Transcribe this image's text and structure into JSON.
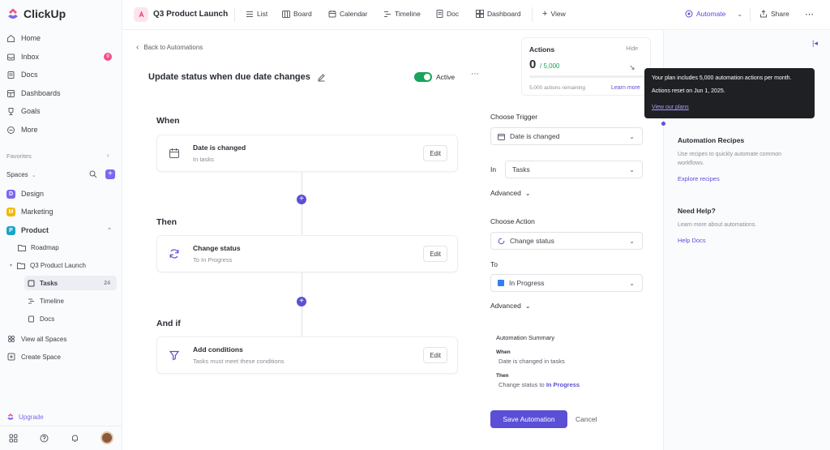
{
  "app": {
    "name": "ClickUp"
  },
  "sidebar": {
    "nav": [
      {
        "label": "Home",
        "icon": "home-icon"
      },
      {
        "label": "Inbox",
        "icon": "inbox-icon",
        "badge": "9"
      },
      {
        "label": "Docs",
        "icon": "doc-icon"
      },
      {
        "label": "Dashboards",
        "icon": "dashboard-icon"
      },
      {
        "label": "Goals",
        "icon": "trophy-icon"
      },
      {
        "label": "More",
        "icon": "more-circle-icon"
      }
    ],
    "favorites_label": "Favorites",
    "spaces_label": "Spaces",
    "spaces": [
      {
        "label": "Design",
        "letter": "D",
        "color": "#7b68ee"
      },
      {
        "label": "Marketing",
        "letter": "M",
        "color": "#f5b800"
      },
      {
        "label": "Product",
        "letter": "P",
        "color": "#1aa3c4"
      }
    ],
    "product_children": {
      "roadmap": "Roadmap",
      "launch": "Q3 Product Launch",
      "tasks": "Tasks",
      "tasks_count": "24",
      "timeline": "Timeline",
      "docs": "Docs"
    },
    "view_all": "View all Spaces",
    "create_space": "Create Space",
    "upgrade": "Upgrade"
  },
  "topbar": {
    "project_title": "Q3 Product Launch",
    "views": [
      "List",
      "Board",
      "Calendar",
      "Timeline",
      "Doc",
      "Dashboard"
    ],
    "add_view": "View",
    "automate": "Automate",
    "share": "Share"
  },
  "builder": {
    "back": "Back to Automations",
    "title": "Update status when due date changes",
    "active_label": "Active",
    "when_label": "When",
    "then_label": "Then",
    "andif_label": "And if",
    "edit_label": "Edit",
    "trigger_card": {
      "title": "Date is changed",
      "sub": "In tasks"
    },
    "action_card": {
      "title": "Change status",
      "sub": "To In Progress"
    },
    "condition_card": {
      "title": "Add conditions",
      "sub": "Tasks must meet these conditions"
    }
  },
  "config": {
    "choose_trigger": "Choose Trigger",
    "trigger_value": "Date is changed",
    "in_label": "In",
    "in_value": "Tasks",
    "advanced": "Advanced",
    "choose_action": "Choose Action",
    "action_value": "Change status",
    "to_label": "To",
    "to_value": "In Progress",
    "to_color": "#2f7ff0",
    "summary": {
      "title": "Automation Summary",
      "when_h": "When",
      "when_v": "Date is changed in tasks",
      "then_h": "Then",
      "then_prefix": "Change status to",
      "then_value": "In Progress"
    },
    "save": "Save Automation",
    "cancel": "Cancel"
  },
  "actions_usage": {
    "title": "Actions",
    "hide": "Hide",
    "used": "0",
    "limit": "/ 5,000",
    "remaining": "5,000 actions remaining",
    "learn_more": "Learn more",
    "progress_fraction": 0
  },
  "tooltip": {
    "line1": "Your plan includes 5,000 automation actions per month.",
    "line2": "Actions reset on Jun 1, 2025.",
    "link": "View our plans"
  },
  "right_panel": {
    "recipes_title": "Automation Recipes",
    "recipes_text": "Use recipes to quickly automate common workflows.",
    "recipes_link": "Explore recipes",
    "help_title": "Need Help?",
    "help_text": "Learn more about automations.",
    "help_link": "Help Docs"
  },
  "colors": {
    "accent": "#5b4fd6",
    "active_green": "#1aa35a"
  }
}
